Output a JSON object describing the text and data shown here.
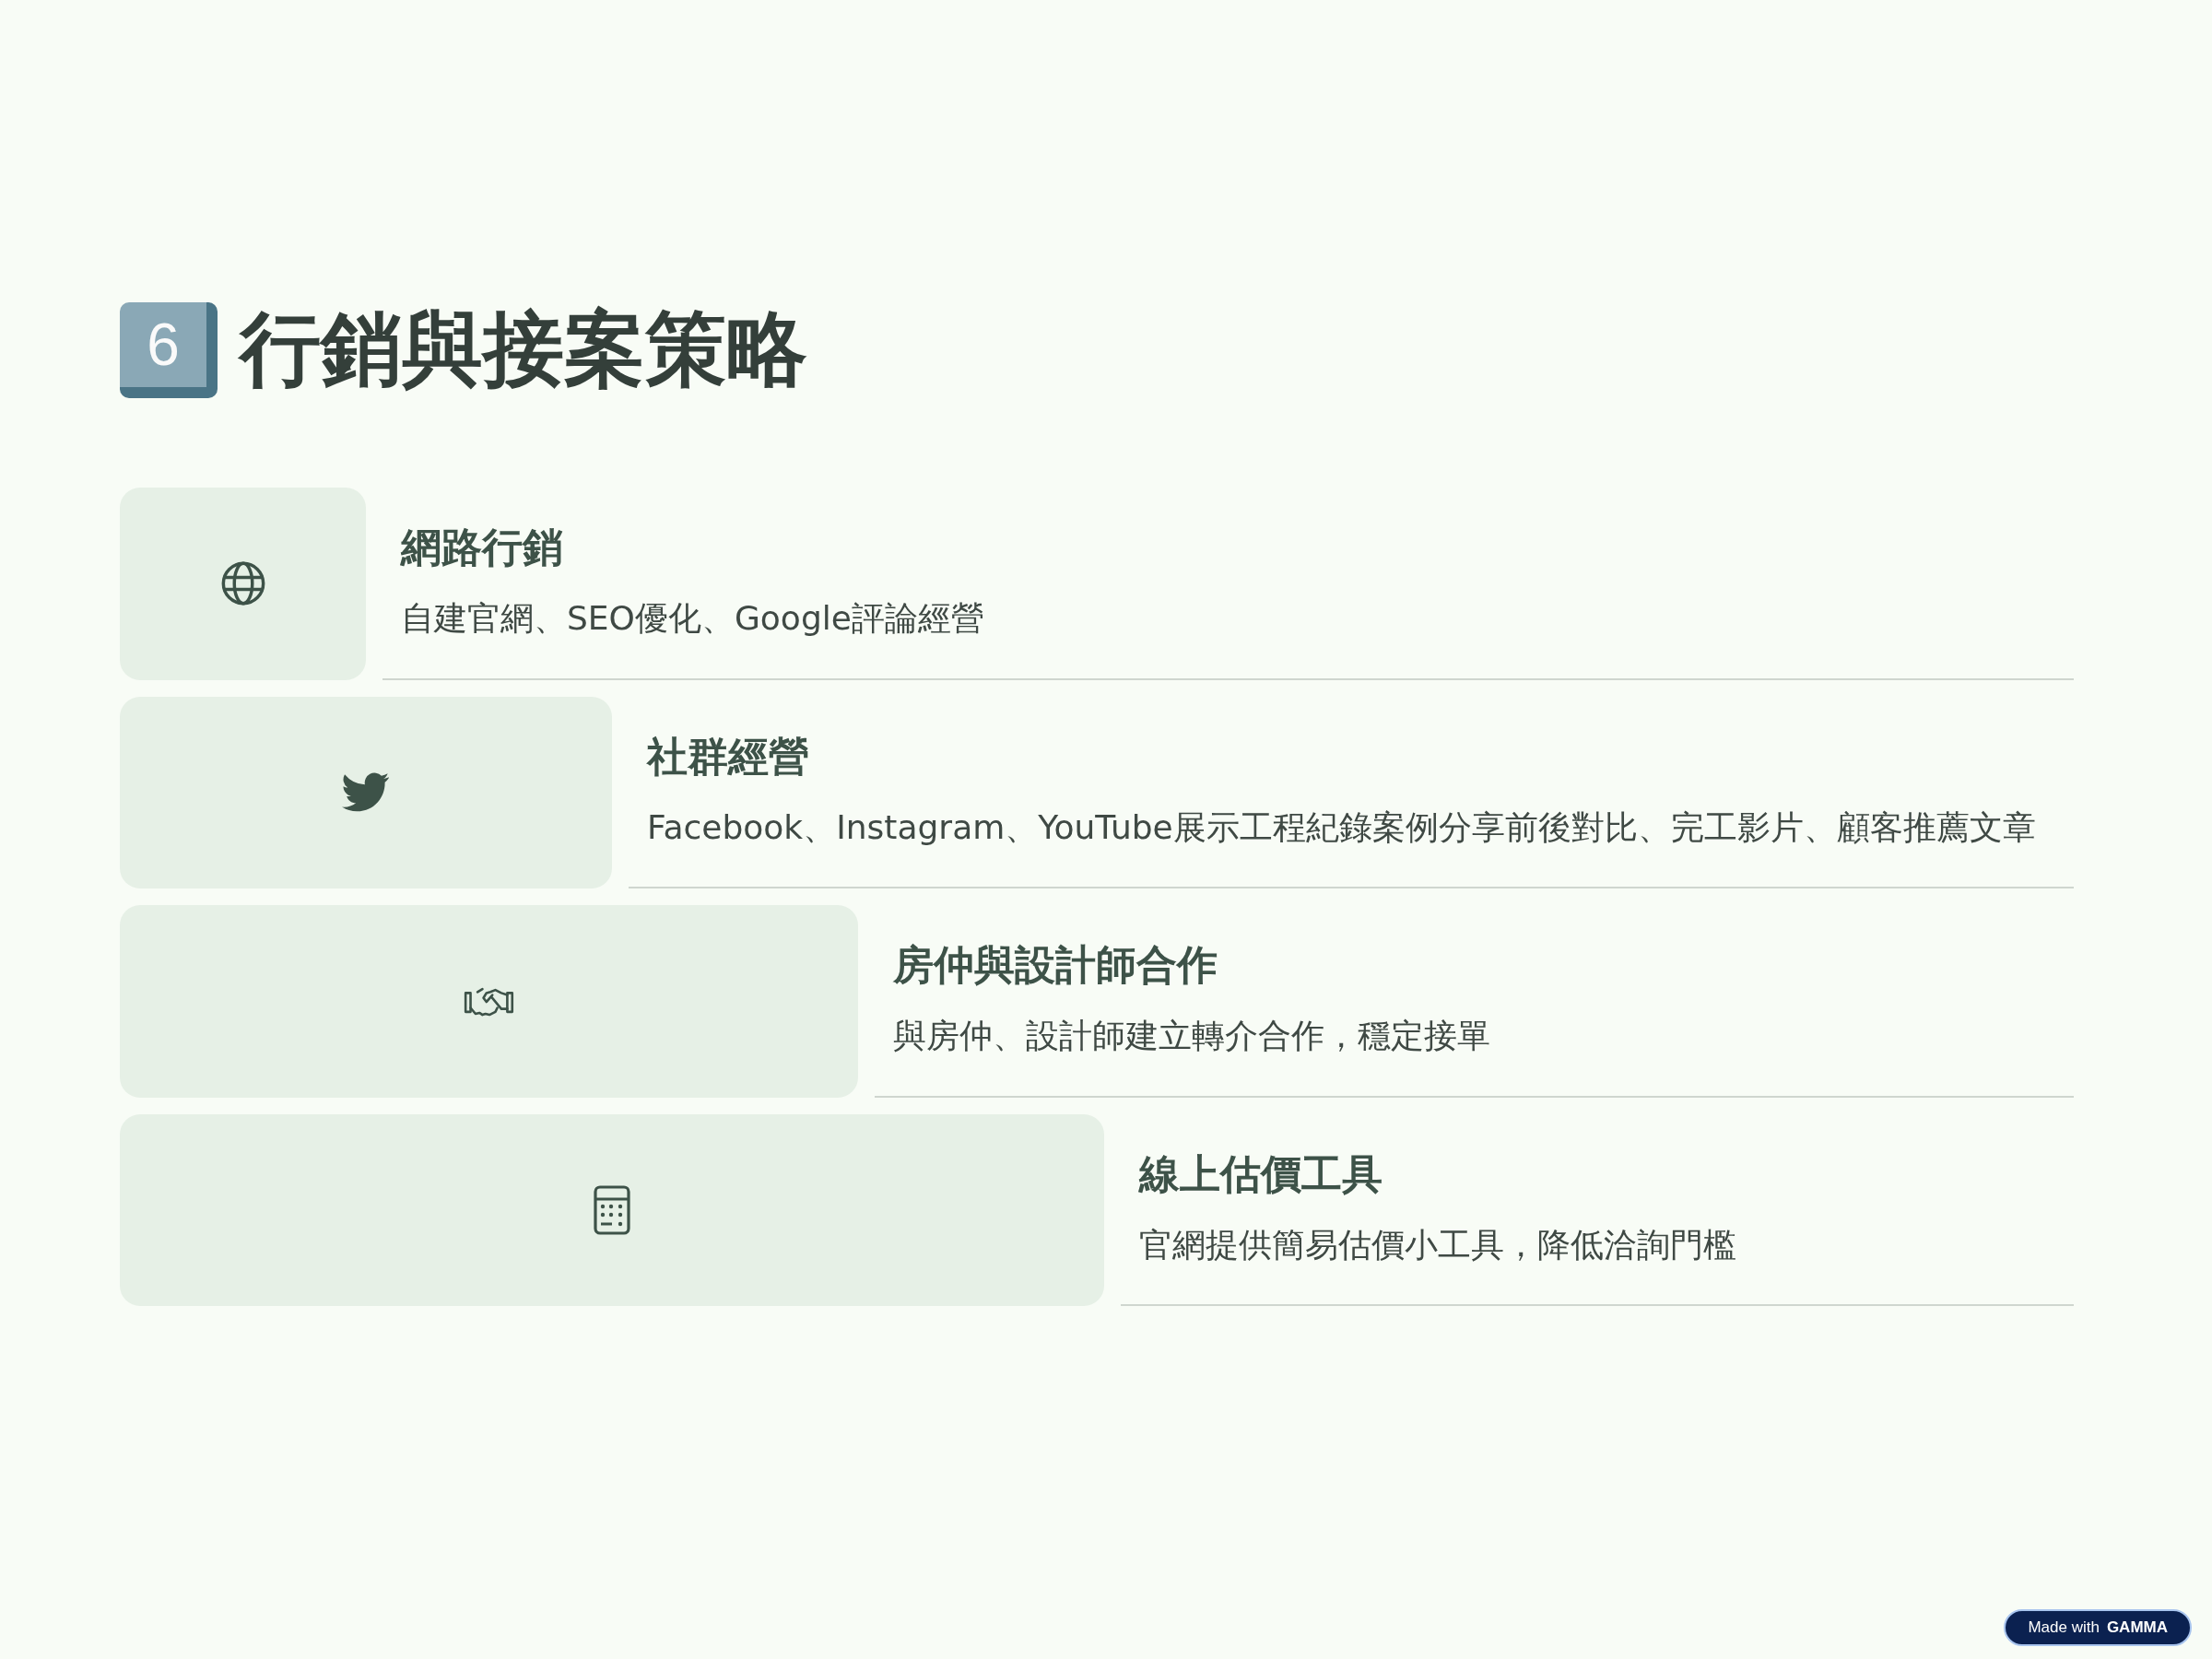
{
  "title": {
    "badge": "6",
    "text": "行銷與接案策略"
  },
  "items": [
    {
      "heading": "網路行銷",
      "description": "自建官網、SEO優化、Google評論經營"
    },
    {
      "heading": "社群經營",
      "description": "Facebook、Instagram、YouTube展示工程紀錄案例分享前後對比、完工影片、顧客推薦文章"
    },
    {
      "heading": "房仲與設計師合作",
      "description": "與房仲、設計師建立轉介合作，穩定接單"
    },
    {
      "heading": "線上估價工具",
      "description": "官網提供簡易估價小工具，降低洽詢門檻"
    }
  ],
  "footer_badge": {
    "prefix": "Made with",
    "brand": "GAMMA"
  }
}
